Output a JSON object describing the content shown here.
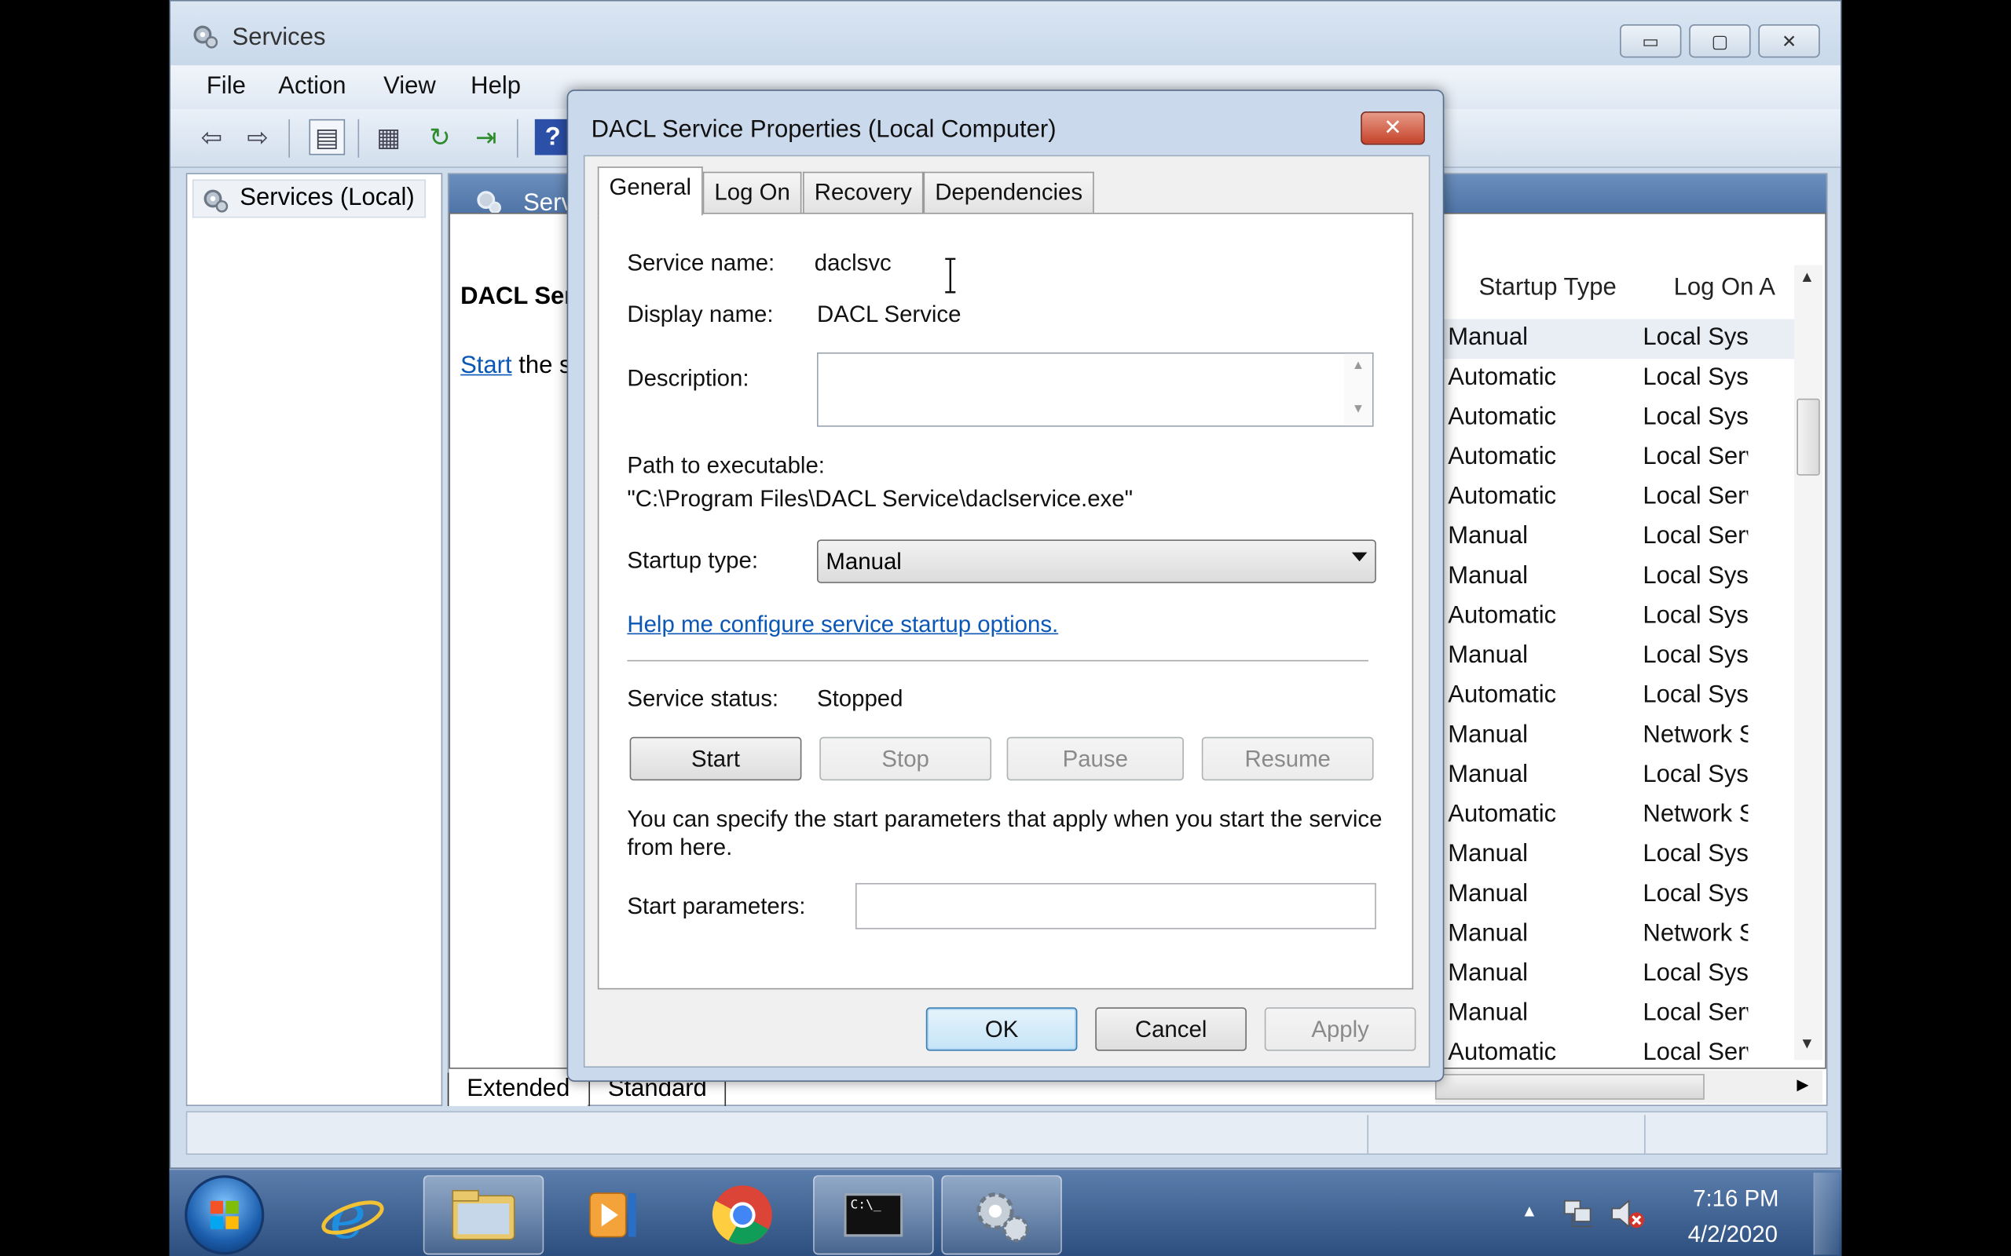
{
  "services_window": {
    "title": "Services",
    "caption": {
      "minimize": "▭",
      "maximize": "▢",
      "close": "✕"
    },
    "menu": [
      "File",
      "Action",
      "View",
      "Help"
    ],
    "left_pane_item": "Services (Local)",
    "right_pane_header": "Serv",
    "desc_title": "DACL Ser",
    "start_link": "Start",
    "start_rest": " the s",
    "columns": {
      "startup_type": "Startup Type",
      "log_on_as": "Log On A"
    },
    "rows": [
      {
        "startup": "Manual",
        "logon": "Local Syst"
      },
      {
        "startup": "Automatic",
        "logon": "Local Syst"
      },
      {
        "startup": "Automatic",
        "logon": "Local Syst"
      },
      {
        "startup": "Automatic",
        "logon": "Local Serv"
      },
      {
        "startup": "Automatic",
        "logon": "Local Serv"
      },
      {
        "startup": "Manual",
        "logon": "Local Serv"
      },
      {
        "startup": "Manual",
        "logon": "Local Syst"
      },
      {
        "startup": "Automatic",
        "logon": "Local Syst"
      },
      {
        "startup": "Manual",
        "logon": "Local Syst"
      },
      {
        "startup": "Automatic",
        "logon": "Local Syst"
      },
      {
        "startup": "Manual",
        "logon": "Network S"
      },
      {
        "startup": "Manual",
        "logon": "Local Syst"
      },
      {
        "startup": "Automatic",
        "logon": "Network S"
      },
      {
        "startup": "Manual",
        "logon": "Local Syst"
      },
      {
        "startup": "Manual",
        "logon": "Local Syst"
      },
      {
        "startup": "Manual",
        "logon": "Network S"
      },
      {
        "startup": "Manual",
        "logon": "Local Syst"
      },
      {
        "startup": "Manual",
        "logon": "Local Serv"
      },
      {
        "startup": "Automatic",
        "logon": "Local Serv"
      }
    ],
    "bottom_tabs": {
      "extended": "Extended",
      "standard": "Standard"
    }
  },
  "dialog": {
    "title": "DACL Service Properties (Local Computer)",
    "close_glyph": "✕",
    "tabs": [
      "General",
      "Log On",
      "Recovery",
      "Dependencies"
    ],
    "service_name_label": "Service name:",
    "service_name_value": "daclsvc",
    "display_name_label": "Display name:",
    "display_name_value": "DACL Service",
    "description_label": "Description:",
    "path_label": "Path to executable:",
    "path_value": "\"C:\\Program Files\\DACL Service\\daclservice.exe\"",
    "startup_type_label": "Startup type:",
    "startup_type_value": "Manual",
    "help_link": "Help me configure service startup options.",
    "status_label": "Service status:",
    "status_value": "Stopped",
    "btn_start": "Start",
    "btn_stop": "Stop",
    "btn_pause": "Pause",
    "btn_resume": "Resume",
    "params_note_line1": "You can specify the start parameters that apply when you start the service",
    "params_note_line2": "from here.",
    "start_params_label": "Start parameters:",
    "start_params_value": "",
    "ok": "OK",
    "cancel": "Cancel",
    "apply": "Apply"
  },
  "taskbar": {
    "clock_time": "7:16 PM",
    "clock_date": "4/2/2020",
    "tray_arrow": "▲",
    "cmd_label": "C:\\_"
  }
}
